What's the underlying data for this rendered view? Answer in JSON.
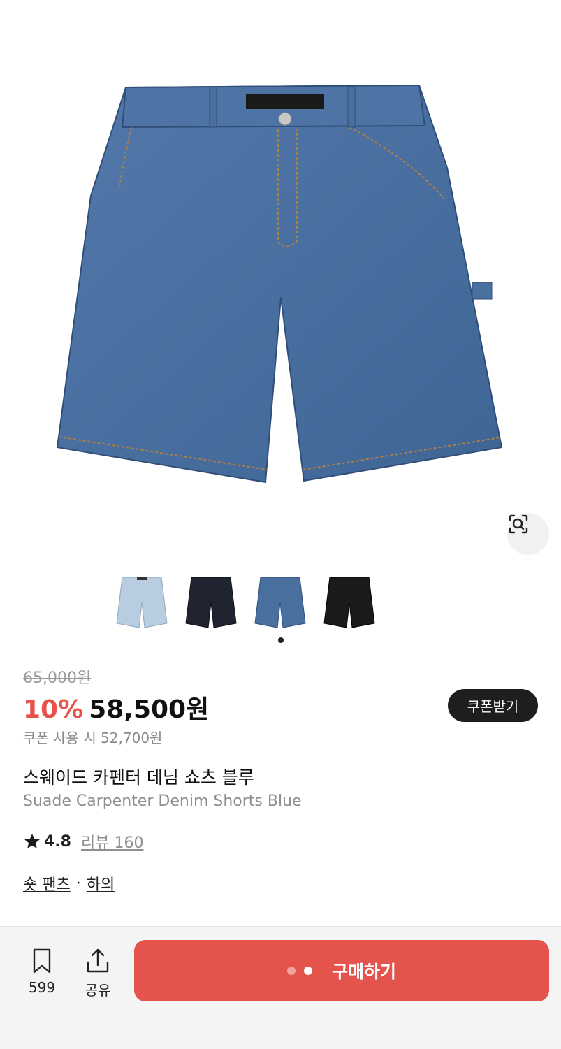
{
  "product": {
    "original_price": "65,000원",
    "discount": "10%",
    "price": "58,500원",
    "coupon_button": "쿠폰받기",
    "coupon_note": "쿠폰 사용 시 52,700원",
    "title_ko": "스웨이드 카펜터 데님 쇼츠 블루",
    "title_en": "Suade Carpenter Denim Shorts Blue",
    "rating": "4.8",
    "review_label": "리뷰 160",
    "category": "숏 팬츠",
    "category_separator": "·",
    "category_parent": "하의"
  },
  "gallery": {
    "thumbnails": [
      {
        "name": "light-wash",
        "color": "#b9cde0"
      },
      {
        "name": "black-navy",
        "color": "#1f2430"
      },
      {
        "name": "blue",
        "color": "#4a70a0"
      },
      {
        "name": "black",
        "color": "#1b1b1b"
      }
    ],
    "icons": {
      "visual_search": "visual-search-icon"
    }
  },
  "bottom_bar": {
    "bookmark_count": "599",
    "share_label": "공유",
    "buy_label": "구매하기"
  },
  "colors": {
    "accent": "#e5544c",
    "discount": "#e8524a",
    "dark_button": "#1e1e1e"
  }
}
